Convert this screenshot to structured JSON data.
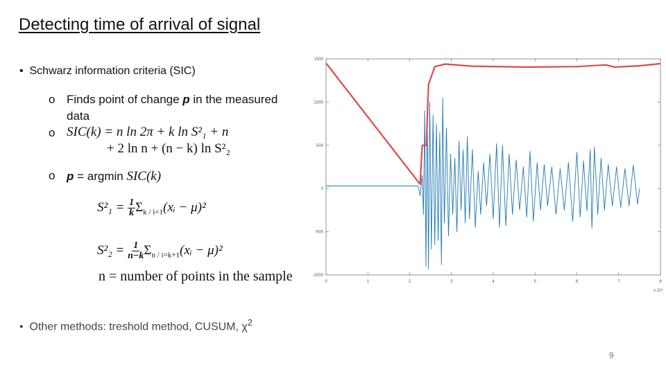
{
  "title": "Detecting time of arrival of signal",
  "bullets": [
    {
      "marker": "•",
      "text": "Schwarz information criteria (SIC)"
    },
    {
      "marker": "•",
      "text": "Other methods: treshold method, CUSUM, χ",
      "sup": "2"
    }
  ],
  "sub_bullets": {
    "marker": "o",
    "finds": {
      "pre": "Finds point of change ",
      "var": "p",
      "post": " in the measured",
      "line2": "data"
    },
    "sic_line1": "SIC(k) = n ln 2π  + k ln S²₁ + n",
    "sic_line2": "+ 2 ln n + (n − k) ln S²₂",
    "p": {
      "var": "p",
      "mid": " = argmin ",
      "expr": "SIC(k)"
    }
  },
  "formulas": {
    "s1": {
      "lhs": "S²₁ = ",
      "num": "1",
      "den": "k",
      "rhs": "Σ",
      "lim": "k / i=1",
      "tail": "(xᵢ − μ)²"
    },
    "s2": {
      "lhs": "S²₂ = ",
      "num": "1",
      "den": "n−k",
      "rhs": "Σ",
      "lim": "n / i=k+1",
      "tail": "(xᵢ − μ)²"
    },
    "n_def": "n = number of points in the sample"
  },
  "page_number": "9",
  "chart_data": {
    "type": "line",
    "xlim": [
      0,
      8
    ],
    "ylim": [
      -1000,
      1500
    ],
    "x_ticks": [
      "0",
      "1",
      "2",
      "3",
      "4",
      "5",
      "6",
      "7",
      "8"
    ],
    "y_ticks": [
      "-1000",
      "-500",
      "0",
      "500",
      "1000",
      "1500"
    ],
    "x_multiplier": "x 10⁴",
    "grid": false,
    "colors": {
      "signal": "#1f77b4",
      "sic": "#e04848"
    },
    "series": [
      {
        "id": "sic",
        "points": [
          [
            0,
            1450
          ],
          [
            2.25,
            50
          ],
          [
            2.3,
            500
          ],
          [
            2.4,
            500
          ],
          [
            2.45,
            1200
          ],
          [
            2.6,
            1410
          ],
          [
            2.85,
            1440
          ],
          [
            3.5,
            1415
          ],
          [
            4.8,
            1405
          ],
          [
            6,
            1410
          ],
          [
            6.7,
            1430
          ],
          [
            6.9,
            1405
          ],
          [
            7.5,
            1420
          ],
          [
            8,
            1445
          ]
        ]
      },
      {
        "id": "signal",
        "points": [
          [
            0,
            30
          ],
          [
            2.2,
            30
          ],
          [
            2.25,
            -80
          ],
          [
            2.3,
            150
          ],
          [
            2.33,
            -300
          ],
          [
            2.36,
            900
          ],
          [
            2.39,
            -900
          ],
          [
            2.42,
            950
          ],
          [
            2.45,
            -930
          ],
          [
            2.48,
            1000
          ],
          [
            2.52,
            -700
          ],
          [
            2.56,
            850
          ],
          [
            2.6,
            -650
          ],
          [
            2.64,
            750
          ],
          [
            2.68,
            -600
          ],
          [
            2.72,
            650
          ],
          [
            2.76,
            -880
          ],
          [
            2.79,
            1050
          ],
          [
            2.83,
            -400
          ],
          [
            2.88,
            700
          ],
          [
            2.93,
            -550
          ],
          [
            2.98,
            400
          ],
          [
            3.03,
            -300
          ],
          [
            3.08,
            350
          ],
          [
            3.13,
            -500
          ],
          [
            3.18,
            550
          ],
          [
            3.23,
            -250
          ],
          [
            3.28,
            450
          ],
          [
            3.33,
            -400
          ],
          [
            3.38,
            600
          ],
          [
            3.43,
            -350
          ],
          [
            3.5,
            450
          ],
          [
            3.57,
            -450
          ],
          [
            3.64,
            200
          ],
          [
            3.7,
            -300
          ],
          [
            3.77,
            300
          ],
          [
            3.84,
            -200
          ],
          [
            3.92,
            400
          ],
          [
            4.0,
            -350
          ],
          [
            4.08,
            520
          ],
          [
            4.15,
            -450
          ],
          [
            4.22,
            500
          ],
          [
            4.3,
            -430
          ],
          [
            4.38,
            400
          ],
          [
            4.46,
            -300
          ],
          [
            4.55,
            330
          ],
          [
            4.63,
            -250
          ],
          [
            4.72,
            250
          ],
          [
            4.8,
            -330
          ],
          [
            4.88,
            430
          ],
          [
            4.96,
            -380
          ],
          [
            5.05,
            300
          ],
          [
            5.13,
            -250
          ],
          [
            5.22,
            280
          ],
          [
            5.3,
            -200
          ],
          [
            5.4,
            250
          ],
          [
            5.5,
            -300
          ],
          [
            5.6,
            230
          ],
          [
            5.7,
            -250
          ],
          [
            5.8,
            300
          ],
          [
            5.9,
            -380
          ],
          [
            6.0,
            420
          ],
          [
            6.08,
            -330
          ],
          [
            6.16,
            320
          ],
          [
            6.24,
            -260
          ],
          [
            6.32,
            450
          ],
          [
            6.36,
            -460
          ],
          [
            6.42,
            480
          ],
          [
            6.5,
            -300
          ],
          [
            6.58,
            350
          ],
          [
            6.66,
            -250
          ],
          [
            6.75,
            280
          ],
          [
            6.85,
            -200
          ],
          [
            6.95,
            250
          ],
          [
            7.05,
            -220
          ],
          [
            7.15,
            230
          ],
          [
            7.25,
            -200
          ],
          [
            7.35,
            270
          ],
          [
            7.45,
            -180
          ],
          [
            7.5,
            0
          ]
        ]
      }
    ]
  }
}
